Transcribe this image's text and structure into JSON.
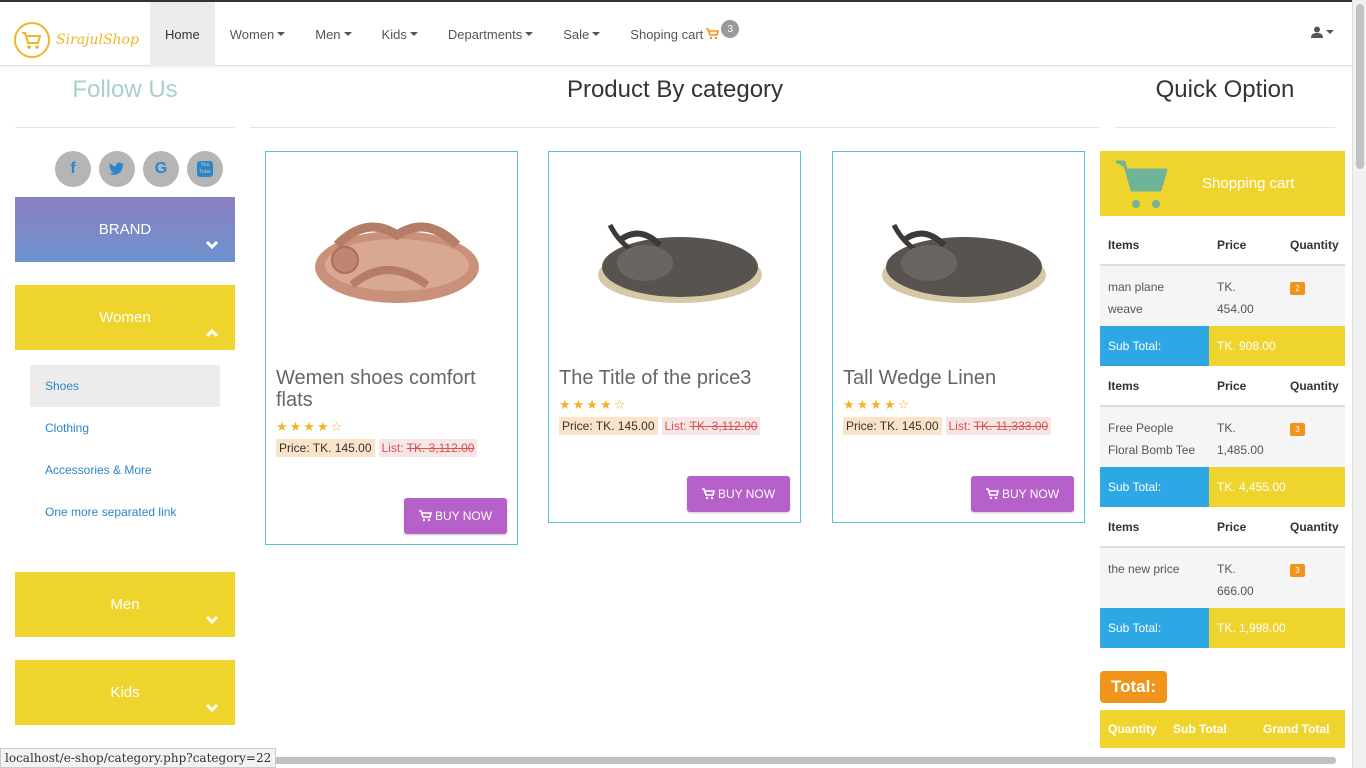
{
  "brand": {
    "logo_text": "SirajulShop"
  },
  "nav": {
    "items": [
      {
        "label": "Home",
        "active": true,
        "dropdown": false
      },
      {
        "label": "Women",
        "dropdown": true
      },
      {
        "label": "Men",
        "dropdown": true
      },
      {
        "label": "Kids",
        "dropdown": true
      },
      {
        "label": "Departments",
        "dropdown": true
      },
      {
        "label": "Sale",
        "dropdown": true
      }
    ],
    "cart_label": "Shoping cart",
    "cart_count": "3"
  },
  "sidebar": {
    "follow_title": "Follow Us",
    "social": [
      "f",
      "t",
      "G",
      "You Tube"
    ],
    "panels": {
      "brand": "BRAND",
      "women": "Women",
      "men": "Men",
      "kids": "Kids"
    },
    "women_items": [
      "Shoes",
      "Clothing",
      "Accessories & More",
      "One more separated link"
    ]
  },
  "main": {
    "title": "Product By category",
    "products": [
      {
        "title": "Wemen shoes comfort flats",
        "stars": "★★★★☆",
        "price": "Price: TK. 145.00",
        "list_label": "List:",
        "list_price": "TK. 3,112.00",
        "buy": "BUY NOW",
        "color": "#c9907a"
      },
      {
        "title": "The Title of the price3",
        "stars": "★★★★☆",
        "price": "Price: TK. 145.00",
        "list_label": "List:",
        "list_price": "TK. 3,112.00",
        "buy": "BUY NOW",
        "color": "#58534f"
      },
      {
        "title": "Tall Wedge Linen",
        "stars": "★★★★☆",
        "price": "Price: TK. 145.00",
        "list_label": "List:",
        "list_price": "TK. 11,333.00",
        "buy": "BUY NOW",
        "color": "#58534f"
      }
    ]
  },
  "quick": {
    "title": "Quick Option",
    "cart_header": "Shopping cart",
    "headers": {
      "items": "Items",
      "price": "Price",
      "quantity": "Quantity"
    },
    "sub_total_label": "Sub Total:",
    "rows": [
      {
        "item_line1": "man plane",
        "item_line2": "weave",
        "price_line1": "TK.",
        "price_line2": "454.00",
        "qty": "2",
        "sub_total": "TK. 908.00"
      },
      {
        "item_line1": "Free People",
        "item_line2": "Floral Bomb Tee",
        "price_line1": "TK.",
        "price_line2": "1,485.00",
        "qty": "3",
        "sub_total": "TK. 4,455.00"
      },
      {
        "item_line1": "the new price",
        "item_line2": "",
        "price_line1": "TK.",
        "price_line2": "666.00",
        "qty": "3",
        "sub_total": "TK. 1,998.00"
      }
    ],
    "total_label": "Total:",
    "total_headers": {
      "quantity": "Quantity",
      "sub_total": "Sub Total",
      "grand_total": "Grand Total"
    }
  },
  "status_url": "localhost/e-shop/category.php?category=22",
  "colors": {
    "yellow": "#f0d42e",
    "purple_btn": "#b660c9",
    "blue": "#2ea8e5",
    "orange": "#f0941a"
  }
}
